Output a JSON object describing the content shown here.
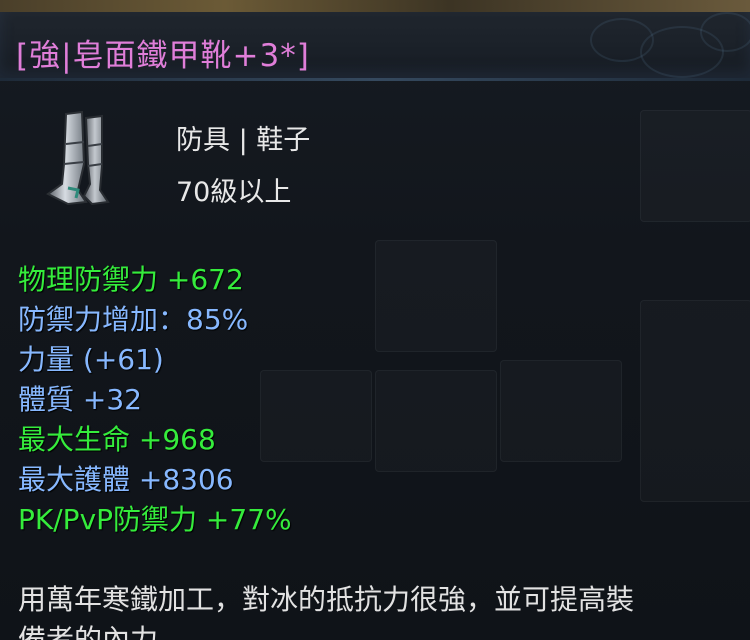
{
  "item": {
    "title": "[強|皂面鐵甲靴+3*]",
    "category": "防具 | 鞋子",
    "level_requirement": "70級以上",
    "icon": "boots-icon"
  },
  "stats": [
    {
      "text": "物理防禦力 +672",
      "color": "#35ec3c"
    },
    {
      "text": "防禦力增加：85%",
      "color": "#87b8ff"
    },
    {
      "text": "力量 (+61)",
      "color": "#87b8ff"
    },
    {
      "text": "體質 +32",
      "color": "#87b8ff"
    },
    {
      "text": "最大生命 +968",
      "color": "#35ec3c"
    },
    {
      "text": "最大護體 +8306",
      "color": "#87b8ff"
    },
    {
      "text": "PK/PvP防禦力 +77%",
      "color": "#35ec3c"
    }
  ],
  "description": {
    "line1": "用萬年寒鐵加工，對冰的抵抗力很強，並可提高裝",
    "line2": "備者的內力。"
  },
  "colors": {
    "title": "#e07ed9",
    "primary_stat": "#35ec3c",
    "secondary_stat": "#87b8ff",
    "text": "#e8e8e8"
  }
}
